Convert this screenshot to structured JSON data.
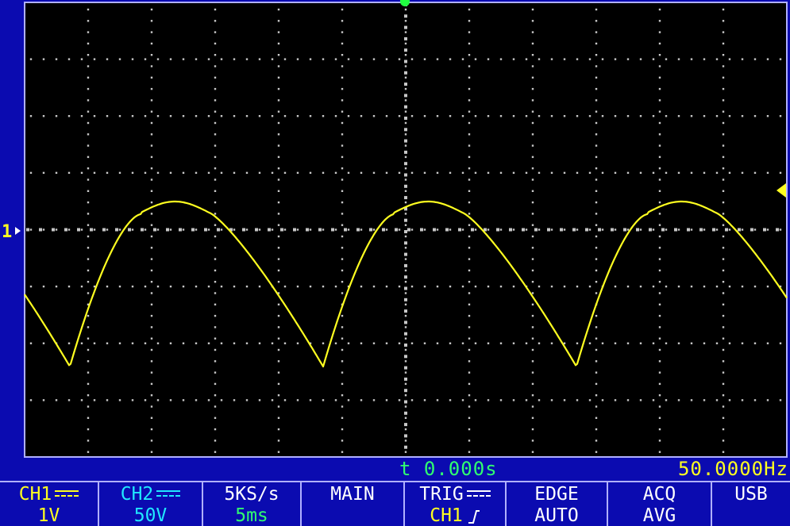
{
  "waveform": {
    "trace_color": "#ffff20",
    "grid_color": "#c8c8c8",
    "background": "#000000",
    "frame_color": "#b0b0ff"
  },
  "markers": {
    "ch1_marker_label": "1"
  },
  "readouts": {
    "time_offset": "t 0.000s",
    "frequency": "50.0000Hz"
  },
  "status": {
    "ch1": {
      "name": "CH1",
      "scale": "1V"
    },
    "ch2": {
      "name": "CH2",
      "scale": "50V"
    },
    "sample_rate": "5KS/s",
    "time_base": "5ms",
    "mode": "MAIN",
    "trig": {
      "label": "TRIG",
      "source": "CH1"
    },
    "edge": {
      "label": "EDGE",
      "mode": "AUTO"
    },
    "acq": {
      "label": "ACQ",
      "mode": "AVG"
    },
    "interface": "USB"
  },
  "icons": {
    "coupling": "dc-coupling-icon",
    "slope": "rising-edge-icon",
    "trigger_level": "trigger-level-arrow-icon",
    "trigger_position": "trigger-position-marker-icon"
  }
}
